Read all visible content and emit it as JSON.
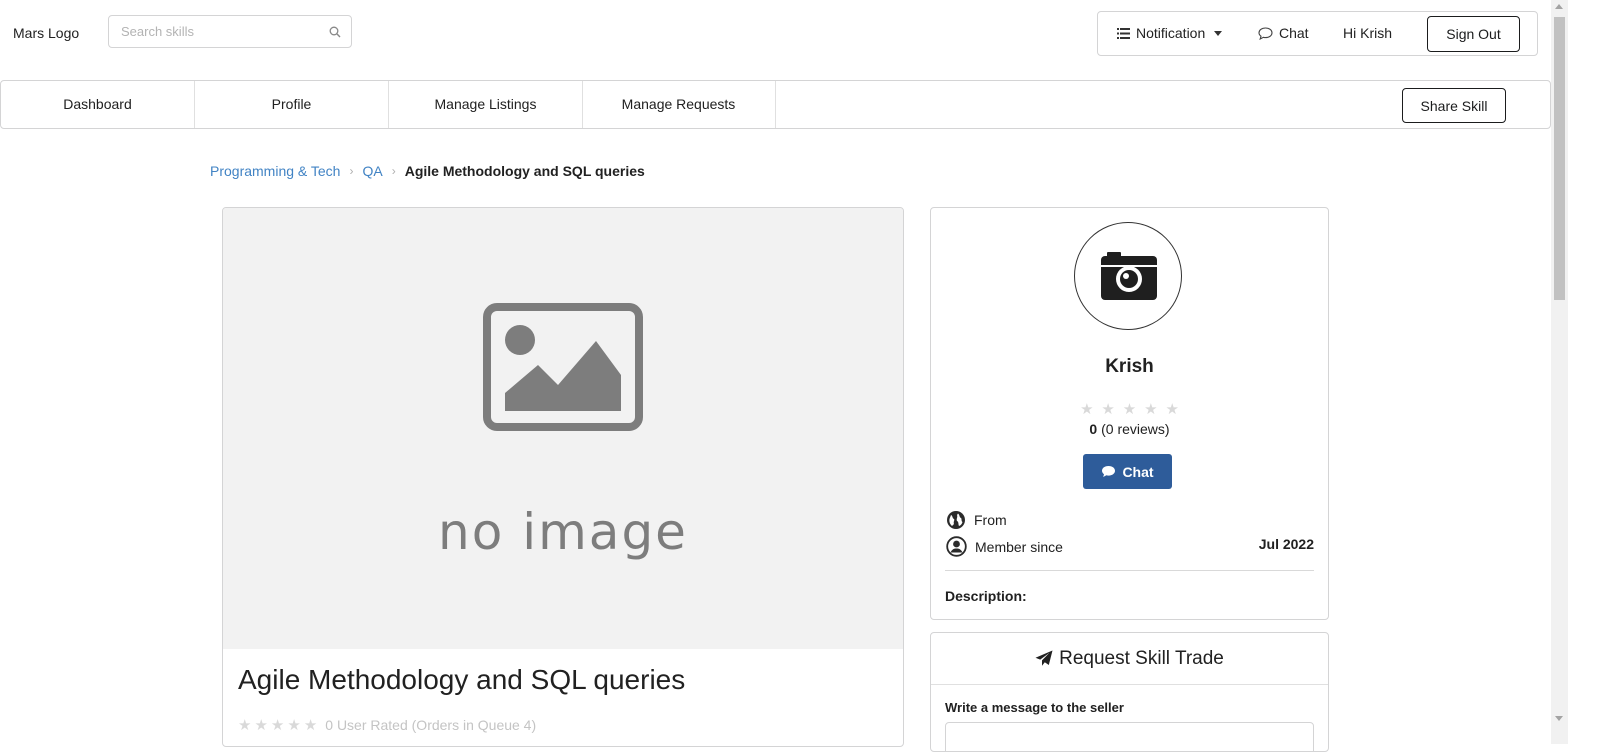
{
  "header": {
    "logo": "Mars Logo",
    "search": {
      "placeholder": "Search skills",
      "value": ""
    },
    "menu": {
      "notification": "Notification",
      "chat": "Chat",
      "greeting": "Hi Krish",
      "sign_out": "Sign Out"
    }
  },
  "nav": {
    "items": [
      {
        "label": "Dashboard"
      },
      {
        "label": "Profile"
      },
      {
        "label": "Manage Listings"
      },
      {
        "label": "Manage Requests"
      }
    ],
    "share_skill": "Share Skill"
  },
  "breadcrumb": {
    "items": [
      "Programming & Tech",
      "QA"
    ],
    "current": "Agile Methodology and SQL queries",
    "separator": "›"
  },
  "skill": {
    "image_placeholder": "no image",
    "title": "Agile Methodology and SQL queries",
    "rating_stars": 0,
    "rating_text": "0 User Rated (Orders in Queue 4)"
  },
  "profile": {
    "name": "Krish",
    "rating_stars": 0,
    "rating_value": "0",
    "reviews_text": "(0 reviews)",
    "chat_button": "Chat",
    "from_label": "From",
    "member_since_label": "Member since",
    "member_since_value": "Jul 2022",
    "description_label": "Description:"
  },
  "trade": {
    "title": "Request Skill Trade",
    "message_label": "Write a message to the seller"
  },
  "colors": {
    "link": "#4183c4",
    "chat_button": "#2e5c9a",
    "star_empty": "#d9d9d9",
    "border": "#d4d4d5"
  }
}
